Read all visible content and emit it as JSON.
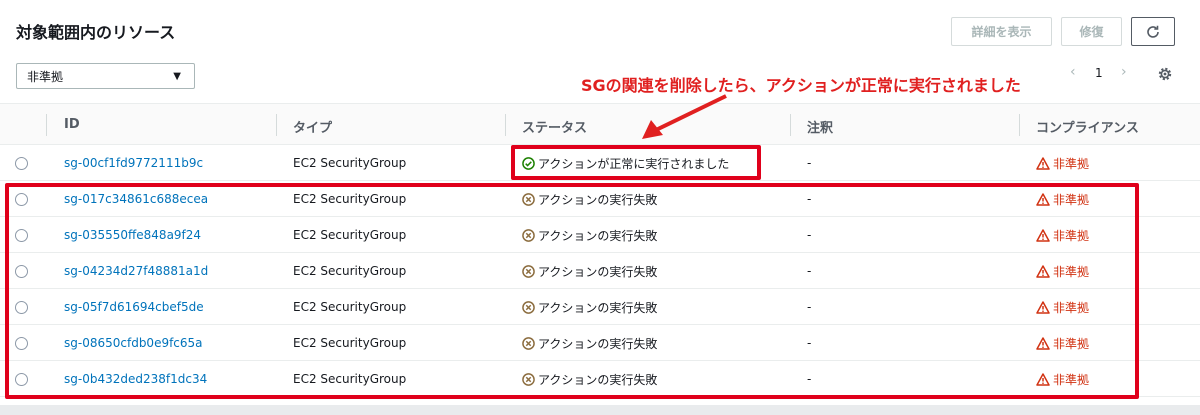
{
  "panel": {
    "title": "対象範囲内のリソース",
    "buttons": {
      "detail": "詳細を表示",
      "repair": "修復"
    },
    "filter": {
      "selected": "非準拠"
    },
    "pager": {
      "prev": "‹",
      "page": "1",
      "next": "›"
    }
  },
  "annotation": {
    "text": "SGの関連を削除したら、アクションが正常に実行されました"
  },
  "table": {
    "headers": {
      "id": "ID",
      "type": "タイプ",
      "status": "ステータス",
      "note": "注釈",
      "compliance": "コンプライアンス"
    },
    "rows": [
      {
        "id": "sg-00cf1fd9772111b9c",
        "type": "EC2 SecurityGroup",
        "status": "アクションが正常に実行されました",
        "status_kind": "success",
        "note": "-",
        "compliance": "非準拠"
      },
      {
        "id": "sg-017c34861c688ecea",
        "type": "EC2 SecurityGroup",
        "status": "アクションの実行失敗",
        "status_kind": "failed",
        "note": "-",
        "compliance": "非準拠"
      },
      {
        "id": "sg-035550ffe848a9f24",
        "type": "EC2 SecurityGroup",
        "status": "アクションの実行失敗",
        "status_kind": "failed",
        "note": "-",
        "compliance": "非準拠"
      },
      {
        "id": "sg-04234d27f48881a1d",
        "type": "EC2 SecurityGroup",
        "status": "アクションの実行失敗",
        "status_kind": "failed",
        "note": "-",
        "compliance": "非準拠"
      },
      {
        "id": "sg-05f7d61694cbef5de",
        "type": "EC2 SecurityGroup",
        "status": "アクションの実行失敗",
        "status_kind": "failed",
        "note": "-",
        "compliance": "非準拠"
      },
      {
        "id": "sg-08650cfdb0e9fc65a",
        "type": "EC2 SecurityGroup",
        "status": "アクションの実行失敗",
        "status_kind": "failed",
        "note": "-",
        "compliance": "非準拠"
      },
      {
        "id": "sg-0b432ded238f1dc34",
        "type": "EC2 SecurityGroup",
        "status": "アクションの実行失敗",
        "status_kind": "failed",
        "note": "-",
        "compliance": "非準拠"
      }
    ]
  },
  "colors": {
    "link": "#0073bb",
    "success": "#1d8102",
    "failed": "#8c6d3f",
    "noncompliant": "#d13212",
    "annotation": "#e02020"
  }
}
